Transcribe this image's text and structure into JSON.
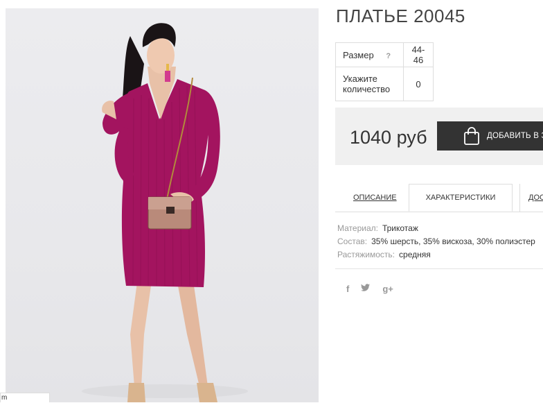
{
  "product": {
    "title": "ПЛАТЬЕ 20045",
    "photo_corner_text": "m"
  },
  "options": {
    "size_label": "Размер",
    "size_help": "?",
    "size_value": "44-46",
    "qty_label": "Укажите количество",
    "qty_value": "0"
  },
  "purchase": {
    "price": "1040 руб",
    "add_to_cart_label": "ДОБАВИТЬ В З"
  },
  "tabs": [
    {
      "label": "ОПИСАНИЕ",
      "active": false
    },
    {
      "label": "ХАРАКТЕРИСТИКИ",
      "active": true
    },
    {
      "label": "ДОС",
      "active": false
    }
  ],
  "properties": [
    {
      "key": "Материал:",
      "value": "Трикотаж"
    },
    {
      "key": "Состав:",
      "value": "35% шерсть, 35% вискоза, 30% полиэстер"
    },
    {
      "key": "Растяжимость:",
      "value": "средняя"
    }
  ],
  "social": {
    "facebook": "f",
    "googleplus": "g+",
    "icons": [
      "facebook-icon",
      "twitter-icon",
      "googleplus-icon"
    ]
  },
  "colors": {
    "dress": "#a3145f",
    "button": "#333333",
    "price_bg": "#f0f0f0"
  }
}
